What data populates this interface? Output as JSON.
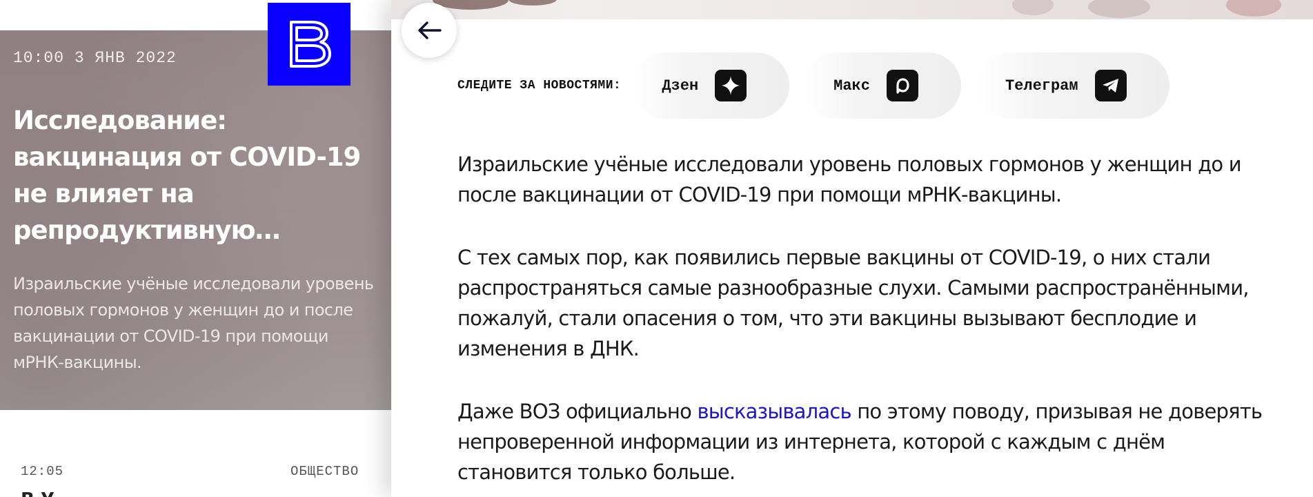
{
  "left": {
    "hero": {
      "date": "10:00 3 ЯНВ 2022",
      "title": "Исследование: вакцинация от COVID-19 не влияет на репродуктивную систем...",
      "lead": "Израильские учёные исследовали уровень половых гормонов у женщин до и после вакцинации от COVID-19 при помощи мРНК-вакцины."
    },
    "feed": {
      "time": "12:05",
      "category": "ОБЩЕСТВО",
      "title_peek": "В У"
    }
  },
  "panel": {
    "follow": {
      "label": "СЛЕДИТЕ ЗА НОВОСТЯМИ:",
      "items": [
        {
          "label": "Дзен",
          "icon": "dzen-icon"
        },
        {
          "label": "Макс",
          "icon": "max-icon"
        },
        {
          "label": "Телеграм",
          "icon": "telegram-icon"
        }
      ]
    },
    "article": {
      "p1": "Израильские учёные исследовали уровень половых гормонов у женщин до и после вакцинации от COVID-19 при помощи мРНК-вакцины.",
      "p2": "С тех самых пор, как появились первые вакцины от COVID-19, о них стали распространяться самые разнообразные слухи. Самыми распространёнными, пожалуй, стали опасения о том, что эти вакцины вызывают бесплодие и изменения в ДНК.",
      "p3_before": "Даже ВОЗ официально ",
      "p3_link": "высказывалась",
      "p3_after": " по этому поводу, призывая не доверять непроверенной информации из интернета, которой с каждым с днём становится только больше."
    }
  },
  "colors": {
    "brand_blue": "#0a00ff",
    "link_blue": "#1b17c9",
    "hero_bg": "#958688",
    "icon_bg": "#111111"
  }
}
